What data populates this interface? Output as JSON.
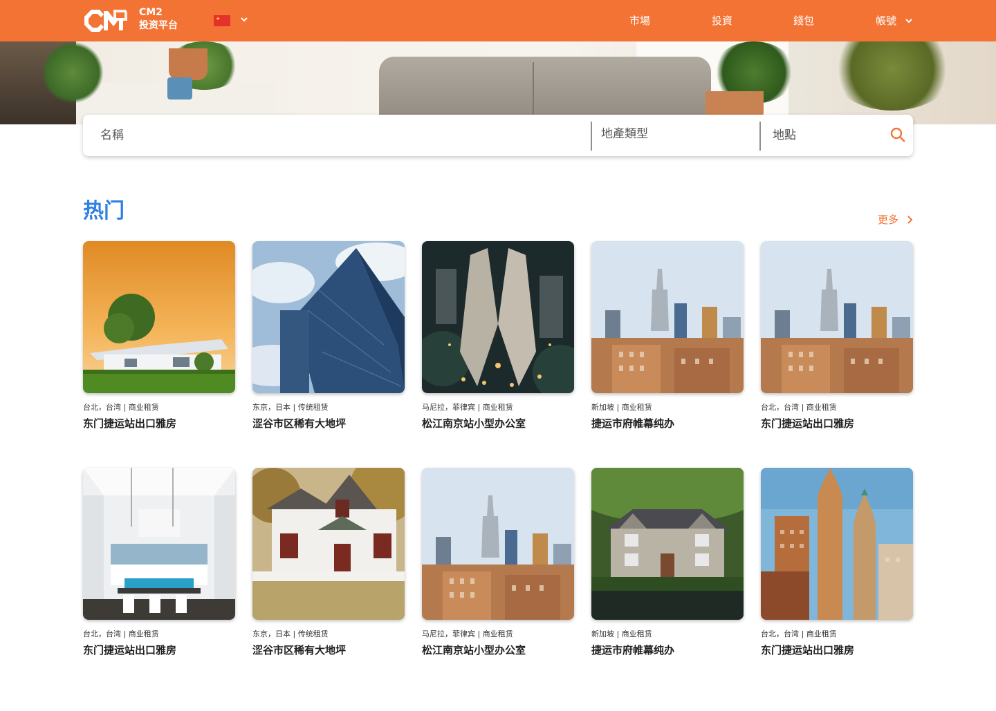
{
  "header": {
    "brand_line1": "CM2",
    "brand_line2": "投资平台",
    "language_flag": "china-flag-icon",
    "nav": {
      "market": "市場",
      "invest": "投資",
      "wallet": "錢包",
      "account": "帳號"
    },
    "accent_color": "#f37335"
  },
  "search": {
    "name_placeholder": "名稱",
    "type_placeholder": "地產類型",
    "location_placeholder": "地點",
    "icon": "search-icon"
  },
  "section": {
    "title": "热门",
    "title_color": "#2f7fe5",
    "more_label": "更多"
  },
  "listings": [
    {
      "meta": "台北，台湾 | 商业租赁",
      "title": "东门捷运站出口雅房",
      "image": "house-sunset"
    },
    {
      "meta": "东京，日本 | 传统租赁",
      "title": "涩谷市区稀有大地坪",
      "image": "glass-tower"
    },
    {
      "meta": "马尼拉，菲律宾 | 商业租赁",
      "title": "松江南京站小型办公室",
      "image": "twin-towers-night"
    },
    {
      "meta": "新加坡 | 商业租赁",
      "title": "捷运市府帷幕纯办",
      "image": "city-skyline"
    },
    {
      "meta": "台北，台湾 | 商业租赁",
      "title": "东门捷运站出口雅房",
      "image": "city-skyline"
    },
    {
      "meta": "台北，台湾 | 商业租赁",
      "title": "东门捷运站出口雅房",
      "image": "kitchen-interior"
    },
    {
      "meta": "东京，日本 | 传统租赁",
      "title": "涩谷市区稀有大地坪",
      "image": "white-cottage"
    },
    {
      "meta": "马尼拉，菲律宾 | 商业租赁",
      "title": "松江南京站小型办公室",
      "image": "city-skyline"
    },
    {
      "meta": "新加坡 | 商业租赁",
      "title": "捷运市府帷幕纯办",
      "image": "stone-manor"
    },
    {
      "meta": "台北，台湾 | 商业租赁",
      "title": "东门捷运站出口雅房",
      "image": "art-deco-towers"
    }
  ]
}
